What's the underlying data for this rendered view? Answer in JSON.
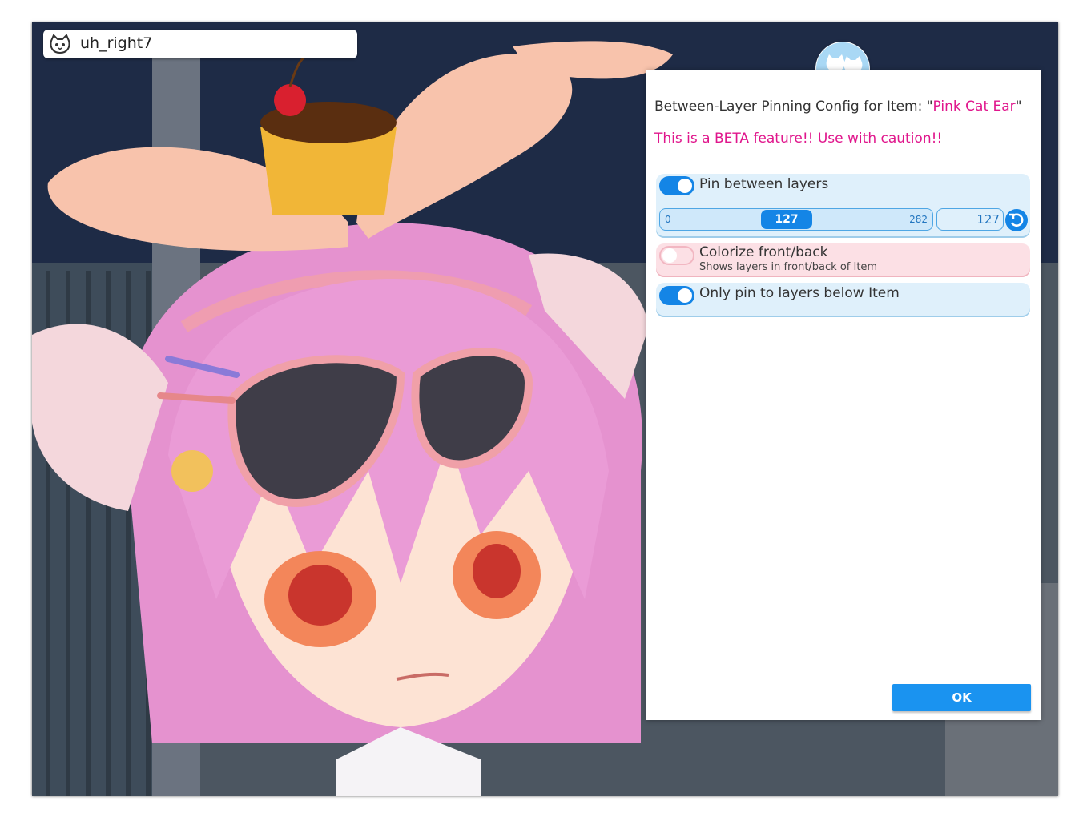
{
  "character": {
    "name": "uh_right7",
    "avatar_icon": "cat-face-icon"
  },
  "dialog": {
    "badge_icon": "cat-family-icon",
    "title_prefix": "Between-Layer Pinning Config for Item: \"",
    "item_name": "Pink Cat Ear",
    "title_suffix": "\"",
    "warning": "This is a BETA feature!! Use with caution!!",
    "options": [
      {
        "label": "Pin between layers",
        "enabled": true,
        "slider": {
          "min": "0",
          "max": "282",
          "value": "127",
          "field_value": "127",
          "reset_icon": "reset-icon"
        }
      },
      {
        "label": "Colorize front/back",
        "sub_label": "Shows layers in front/back of Item",
        "enabled": false
      },
      {
        "label": "Only pin to layers below Item",
        "enabled": true
      }
    ],
    "ok_label": "OK"
  },
  "colors": {
    "accent": "#1485e6",
    "warning": "#e0168c",
    "option_bg": "#dff0fb",
    "option_off_bg": "#fce0e5"
  }
}
